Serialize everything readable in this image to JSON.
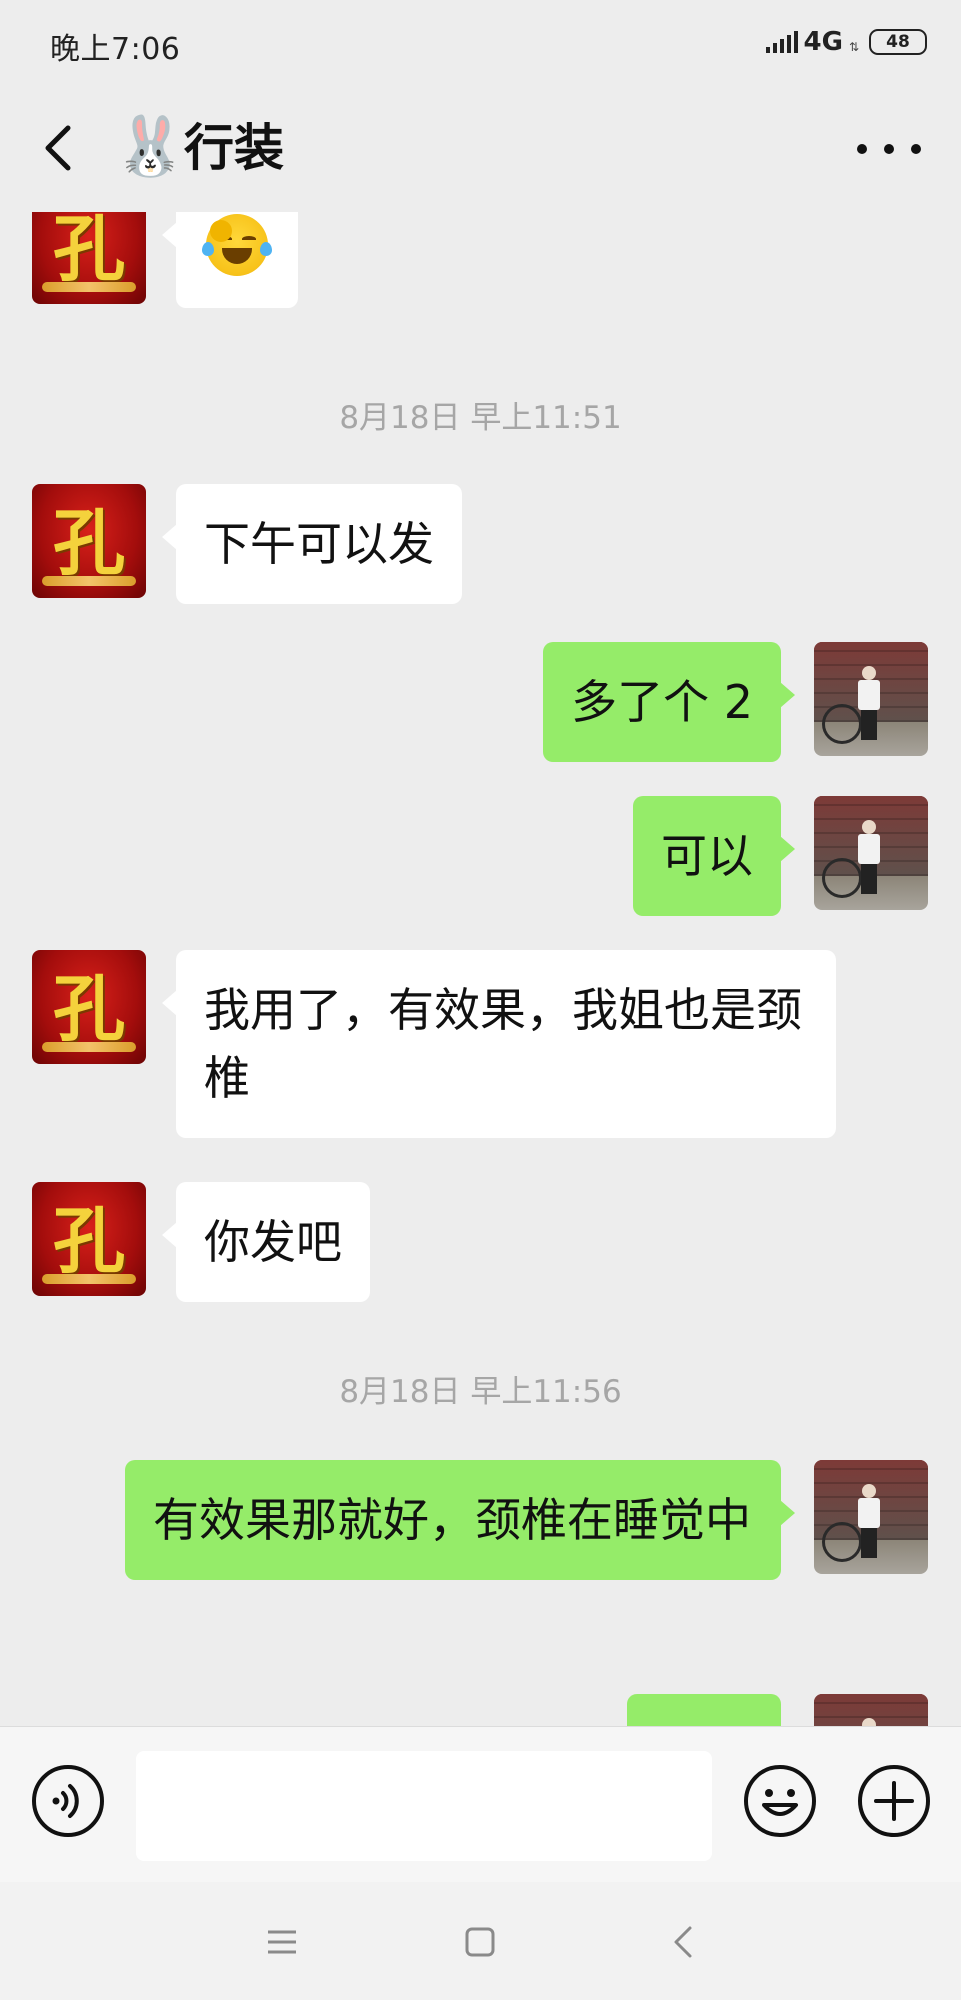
{
  "status_bar": {
    "time": "晚上7:06",
    "network": "4G",
    "battery": "48"
  },
  "header": {
    "title_emoji": "🐰",
    "title": "行装"
  },
  "messages": [
    {
      "side": "left",
      "type": "emoji",
      "avatar": "kong-avatar",
      "emoji": "crying-laughing-emoji"
    },
    {
      "type": "timestamp",
      "text": "8月18日 早上11:51"
    },
    {
      "side": "left",
      "type": "text",
      "avatar": "kong-avatar",
      "text": "下午可以发"
    },
    {
      "side": "right",
      "type": "text",
      "avatar": "self-photo-avatar",
      "text": "多了个 2"
    },
    {
      "side": "right",
      "type": "text",
      "avatar": "self-photo-avatar",
      "text": "可以"
    },
    {
      "side": "left",
      "type": "text",
      "avatar": "kong-avatar",
      "text": "我用了，有效果，我姐也是颈椎"
    },
    {
      "side": "left",
      "type": "text",
      "avatar": "kong-avatar",
      "text": "你发吧"
    },
    {
      "type": "timestamp",
      "text": "8月18日 早上11:56"
    },
    {
      "side": "right",
      "type": "text",
      "avatar": "self-photo-avatar",
      "text": "有效果那就好，颈椎在睡觉中"
    },
    {
      "side": "right",
      "type": "text",
      "avatar": "self-photo-avatar",
      "text": ""
    }
  ],
  "avatar_text": {
    "kong": "孔"
  },
  "input": {
    "value": "",
    "placeholder": ""
  },
  "colors": {
    "background": "#ededed",
    "bubble_self": "#95ec69",
    "bubble_other": "#ffffff",
    "timestamp_text": "#a6a6a6"
  },
  "icons": {
    "back": "chevron-left-icon",
    "more": "more-dots-icon",
    "voice": "voice-icon",
    "emoji": "smiley-icon",
    "plus": "plus-icon",
    "nav_menu": "menu-icon",
    "nav_home": "home-square-icon",
    "nav_back": "nav-back-icon"
  }
}
